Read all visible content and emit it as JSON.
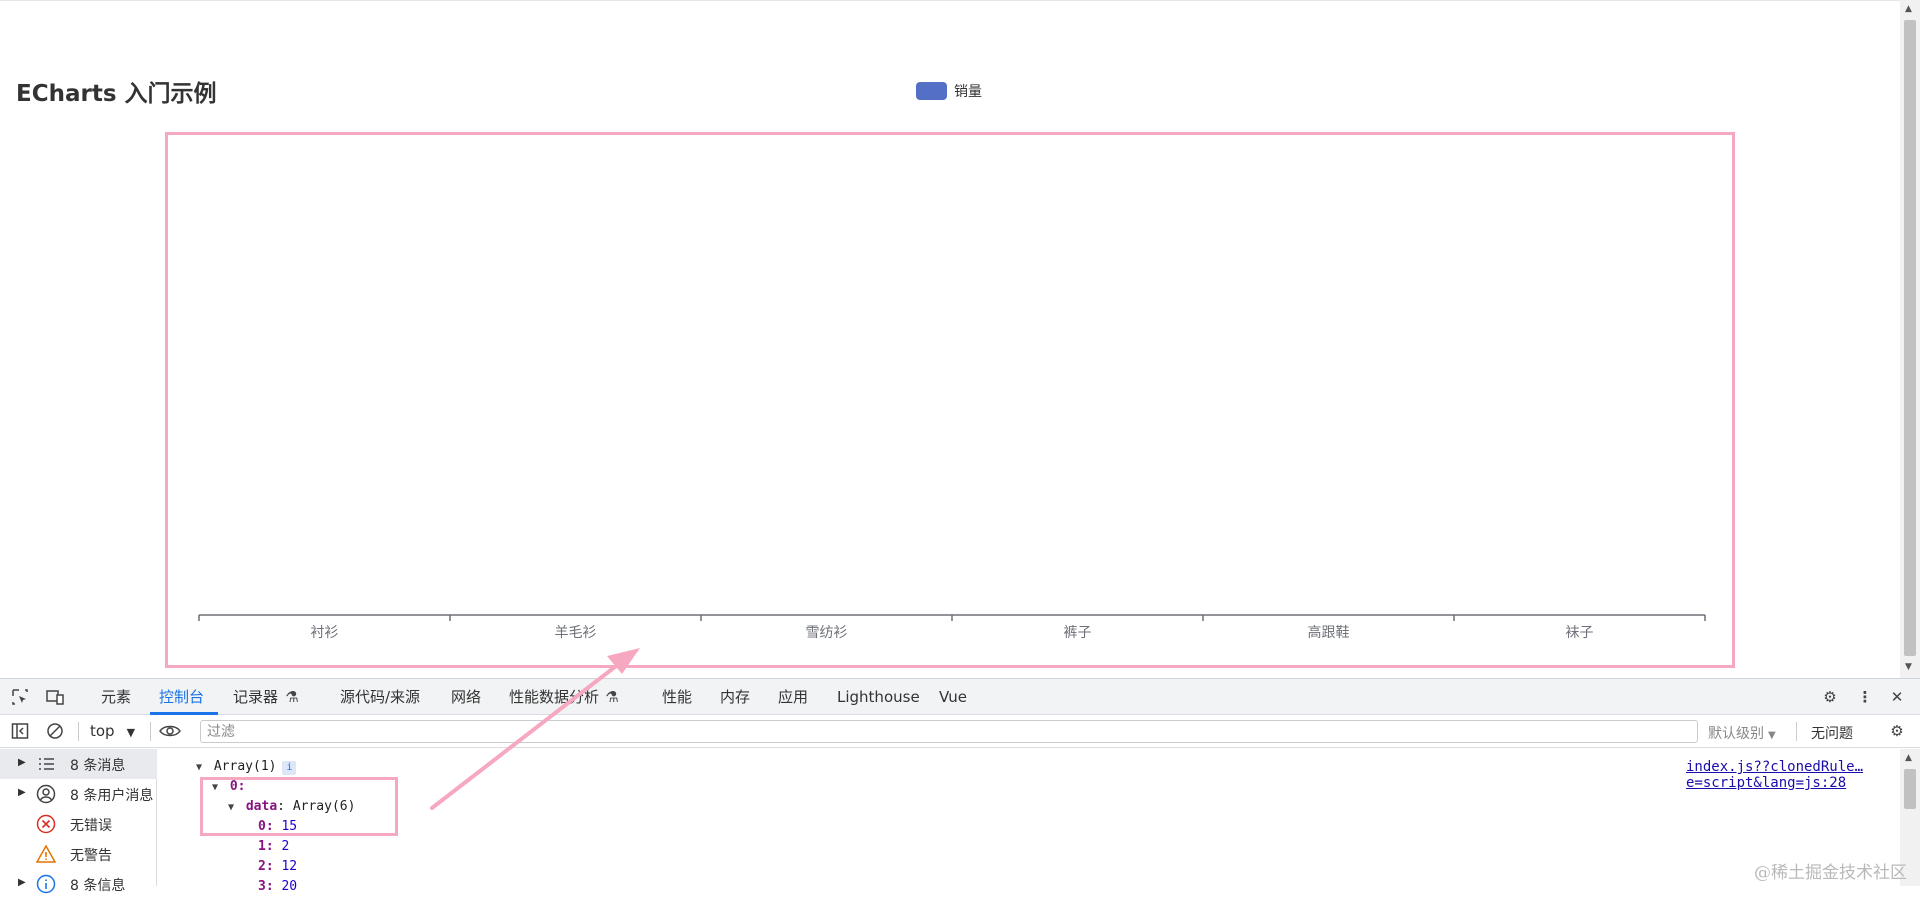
{
  "page": {
    "title": "ECharts 入门示例"
  },
  "chart_data": {
    "type": "bar",
    "title": "ECharts 入门示例",
    "legend": [
      "销量"
    ],
    "legend_position": "top-center",
    "series": [
      {
        "name": "销量",
        "values": [],
        "color": "#5470c6"
      }
    ],
    "categories": [
      "衬衫",
      "羊毛衫",
      "雪纺衫",
      "裤子",
      "高跟鞋",
      "袜子"
    ],
    "grid": false
  },
  "devtools": {
    "tabs": [
      {
        "label": "元素",
        "active": false
      },
      {
        "label": "控制台",
        "active": true
      },
      {
        "label": "记录器",
        "active": false
      },
      {
        "label": "源代码/来源",
        "active": false
      },
      {
        "label": "网络",
        "active": false
      },
      {
        "label": "性能数据分析",
        "active": false
      },
      {
        "label": "性能",
        "active": false
      },
      {
        "label": "内存",
        "active": false
      },
      {
        "label": "应用",
        "active": false
      },
      {
        "label": "Lighthouse",
        "active": false
      },
      {
        "label": "Vue",
        "active": false
      }
    ],
    "toolbar": {
      "context": "top",
      "filter_placeholder": "过滤",
      "level": "默认级别",
      "issues": "无问题"
    },
    "sidebar": [
      {
        "label": "8 条消息",
        "icon": "list-icon",
        "selected": true
      },
      {
        "label": "8 条用户消息",
        "icon": "user-icon",
        "selected": false
      },
      {
        "label": "无错误",
        "icon": "error-icon",
        "selected": false
      },
      {
        "label": "无警告",
        "icon": "warning-icon",
        "selected": false
      },
      {
        "label": "8 条信息",
        "icon": "info-icon",
        "selected": false
      }
    ],
    "console": {
      "array_header": "Array(1)",
      "index_key": "0:",
      "data_key": "data",
      "data_value": "Array(6)",
      "items": [
        {
          "key": "0",
          "value": "15"
        },
        {
          "key": "1",
          "value": "2"
        },
        {
          "key": "2",
          "value": "12"
        },
        {
          "key": "3",
          "value": "20"
        }
      ],
      "source_link": "index.js??clonedRule…e=script&lang=js:28"
    }
  },
  "watermark": "@稀土掘金技术社区",
  "colors": {
    "accent": "#1a73e8",
    "highlight": "#f5a8bf",
    "series": "#5470c6"
  }
}
